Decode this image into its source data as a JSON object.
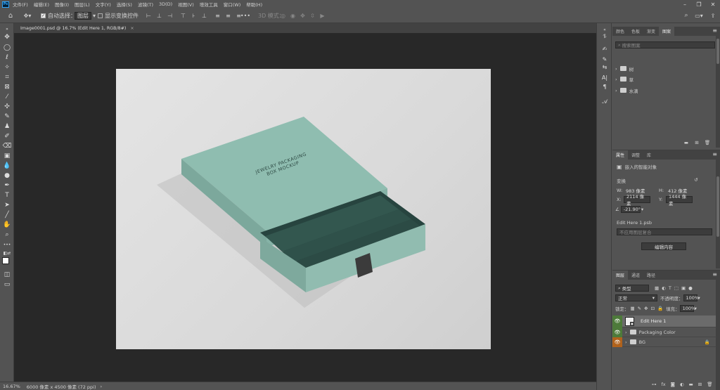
{
  "app": {
    "logo": "Ps"
  },
  "menu": [
    "文件(F)",
    "编辑(E)",
    "图像(I)",
    "图层(L)",
    "文字(Y)",
    "选择(S)",
    "滤镜(T)",
    "3D(D)",
    "视图(V)",
    "增效工具",
    "窗口(W)",
    "帮助(H)"
  ],
  "options": {
    "auto_select_label": "自动选择：",
    "auto_select_value": "图层",
    "transform_controls_label": "显示变换控件",
    "mode_3d_label": "3D 模式：",
    "more_label": "•••"
  },
  "document_tab": {
    "title": "Image0001.psd @ 16.7% (Edit Here 1, RGB/8#)",
    "close": "×"
  },
  "mockup_text": {
    "line1": "JEWELRY PACKAGING",
    "line2": "BOX MOCKUP"
  },
  "status": {
    "zoom": "16.67%",
    "doc_info": "6000 像素 x 4500 像素 (72 ppi)",
    "arrow": "›"
  },
  "panel_top": {
    "tabs": [
      "颜色",
      "色板",
      "渐变",
      "图案"
    ],
    "active_tab": "图案",
    "search_placeholder": "搜索图案",
    "groups": [
      {
        "label": "树"
      },
      {
        "label": "草"
      },
      {
        "label": "水滴"
      }
    ]
  },
  "properties": {
    "tabs": [
      "属性",
      "调整",
      "库"
    ],
    "active_tab": "属性",
    "object_type": "嵌入的智能对象",
    "transform_label": "变换",
    "w_label": "W:",
    "w_value": "983 像素",
    "h_label": "H:",
    "h_value": "412 像素",
    "x_label": "X:",
    "x_value": "2114 像素",
    "y_label": "Y:",
    "y_value": "1444 像素",
    "angle_value": "-21.90°",
    "file_name": "Edit Here 1.psb",
    "layer_comp_placeholder": "不应用图层复合",
    "edit_contents_label": "编辑内容"
  },
  "layers": {
    "tabs": [
      "图层",
      "通道",
      "路径"
    ],
    "active_tab": "图层",
    "filter_label": "类型",
    "blend_mode": "正常",
    "opacity_label": "不透明度：",
    "opacity_value": "100%",
    "lock_label": "锁定：",
    "fill_label": "填充：",
    "fill_value": "100%",
    "items": [
      {
        "name": "Edit Here 1",
        "eye_color": "#4d7a3a",
        "type": "smart-object"
      },
      {
        "name": "Packaging Color",
        "eye_color": "#4d7a3a",
        "type": "group"
      },
      {
        "name": "BG",
        "eye_color": "#b0621c",
        "type": "group"
      }
    ]
  },
  "colors": {
    "accent_green": "#4d7a3a",
    "accent_orange": "#b0621c",
    "box_teal": "#8fbdb0",
    "velvet": "#2e504a"
  }
}
